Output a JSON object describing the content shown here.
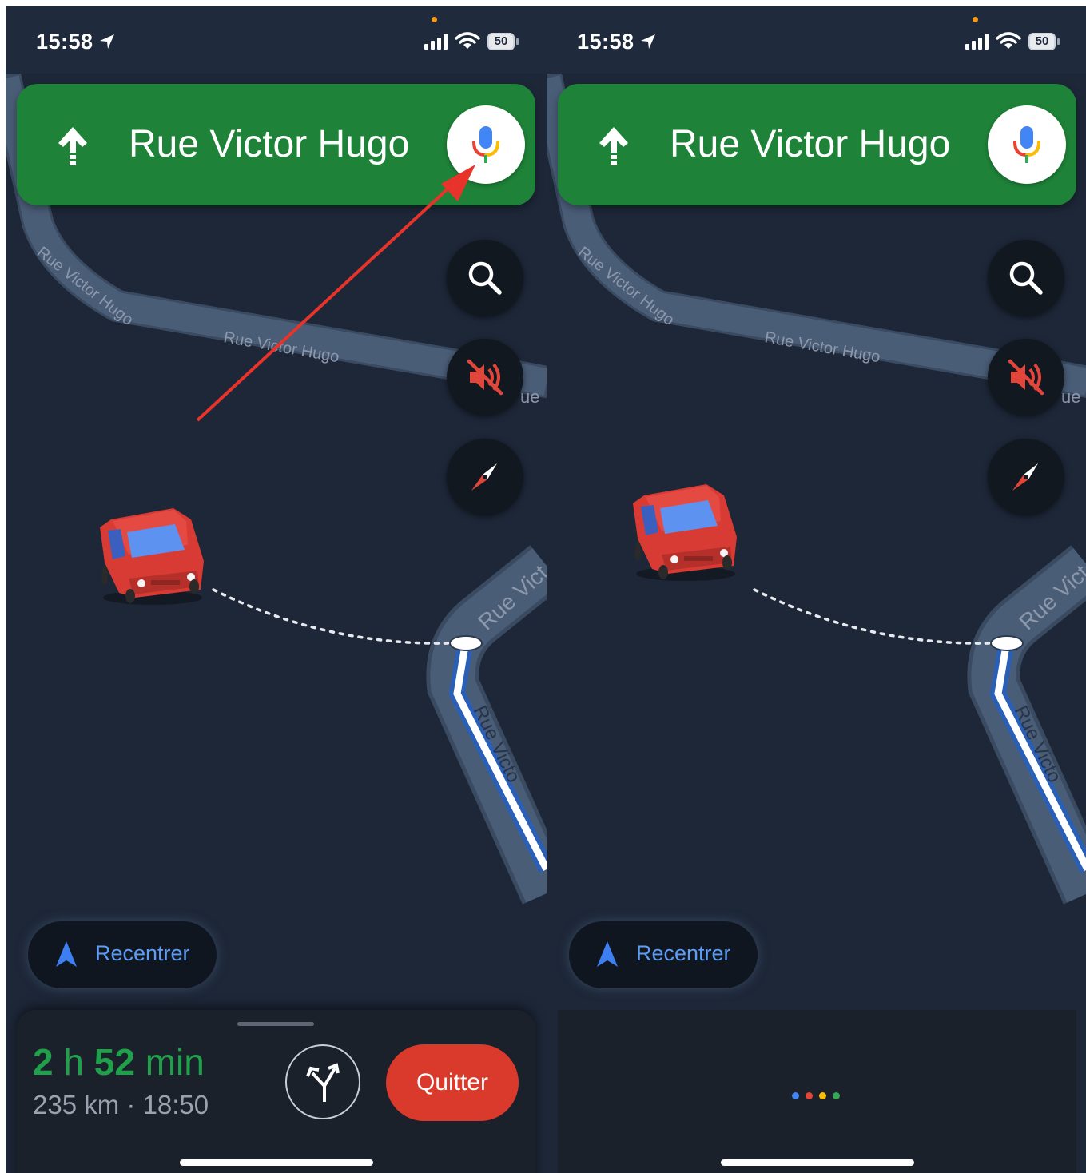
{
  "screens": [
    {
      "id": "left",
      "status_bar": {
        "time": "15:58",
        "battery": "50"
      },
      "nav_banner": {
        "direction": "up-arrow-icon",
        "street": "Rue Victor Hugo"
      },
      "map": {
        "street_labels": [
          "Rue Victor Hugo",
          "Rue Victor Hugo",
          "Rue Victor Hugo",
          "Rue Vict",
          "ue",
          "Rue Victo"
        ]
      },
      "recenter": {
        "label": "Recentrer"
      },
      "trip": {
        "duration_h": "2",
        "h": "h",
        "duration_min": "52",
        "min": "min",
        "distance": "235 km",
        "arrival": "18:50",
        "separator": "·"
      },
      "quit": {
        "label": "Quitter"
      },
      "annotation": "red-arrow-pointing-to-mic"
    },
    {
      "id": "right",
      "status_bar": {
        "time": "15:58",
        "battery": "50"
      },
      "nav_banner": {
        "direction": "up-arrow-icon",
        "street": "Rue Victor Hugo"
      },
      "map": {
        "street_labels": [
          "Rue Victor Hugo",
          "Rue Victor Hugo",
          "Rue Victor Hugo",
          "Rue Vict",
          "ue",
          "Rue Victo"
        ]
      },
      "recenter": {
        "label": "Recentrer"
      },
      "assistant": {
        "state": "listening",
        "dot_colors": [
          "#4285f4",
          "#ea4335",
          "#fbbc05",
          "#34a853"
        ]
      }
    }
  ],
  "colors": {
    "map_bg": "#1d2738",
    "road": "#3d4e66",
    "banner_green": "#1e8338",
    "quit_red": "#d93a2c",
    "eta_green": "#20a04a",
    "recenter_blue": "#5e9df5",
    "annotation_red": "#e8332a"
  }
}
